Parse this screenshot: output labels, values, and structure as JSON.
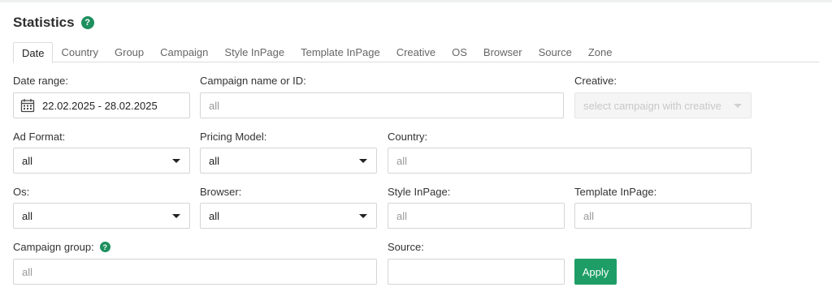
{
  "header": {
    "title": "Statistics",
    "help": "?"
  },
  "tabs": [
    "Date",
    "Country",
    "Group",
    "Campaign",
    "Style InPage",
    "Template InPage",
    "Creative",
    "OS",
    "Browser",
    "Source",
    "Zone"
  ],
  "filters": {
    "date_range": {
      "label": "Date range:",
      "value": "22.02.2025 - 28.02.2025"
    },
    "campaign": {
      "label": "Campaign name or ID:",
      "placeholder": "all"
    },
    "creative": {
      "label": "Creative:",
      "placeholder": "select campaign with creative"
    },
    "ad_format": {
      "label": "Ad Format:",
      "value": "all"
    },
    "pricing_model": {
      "label": "Pricing Model:",
      "value": "all"
    },
    "country": {
      "label": "Country:",
      "placeholder": "all"
    },
    "os": {
      "label": "Os:",
      "value": "all"
    },
    "browser": {
      "label": "Browser:",
      "value": "all"
    },
    "style_inpage": {
      "label": "Style InPage:",
      "placeholder": "all"
    },
    "template_inpage": {
      "label": "Template InPage:",
      "placeholder": "all"
    },
    "campaign_group": {
      "label": "Campaign group:",
      "placeholder": "all",
      "help": "?"
    },
    "source": {
      "label": "Source:",
      "placeholder": ""
    }
  },
  "apply_label": "Apply",
  "colors": {
    "accent": "#1e9e66",
    "help_badge": "#1e8f5e"
  }
}
